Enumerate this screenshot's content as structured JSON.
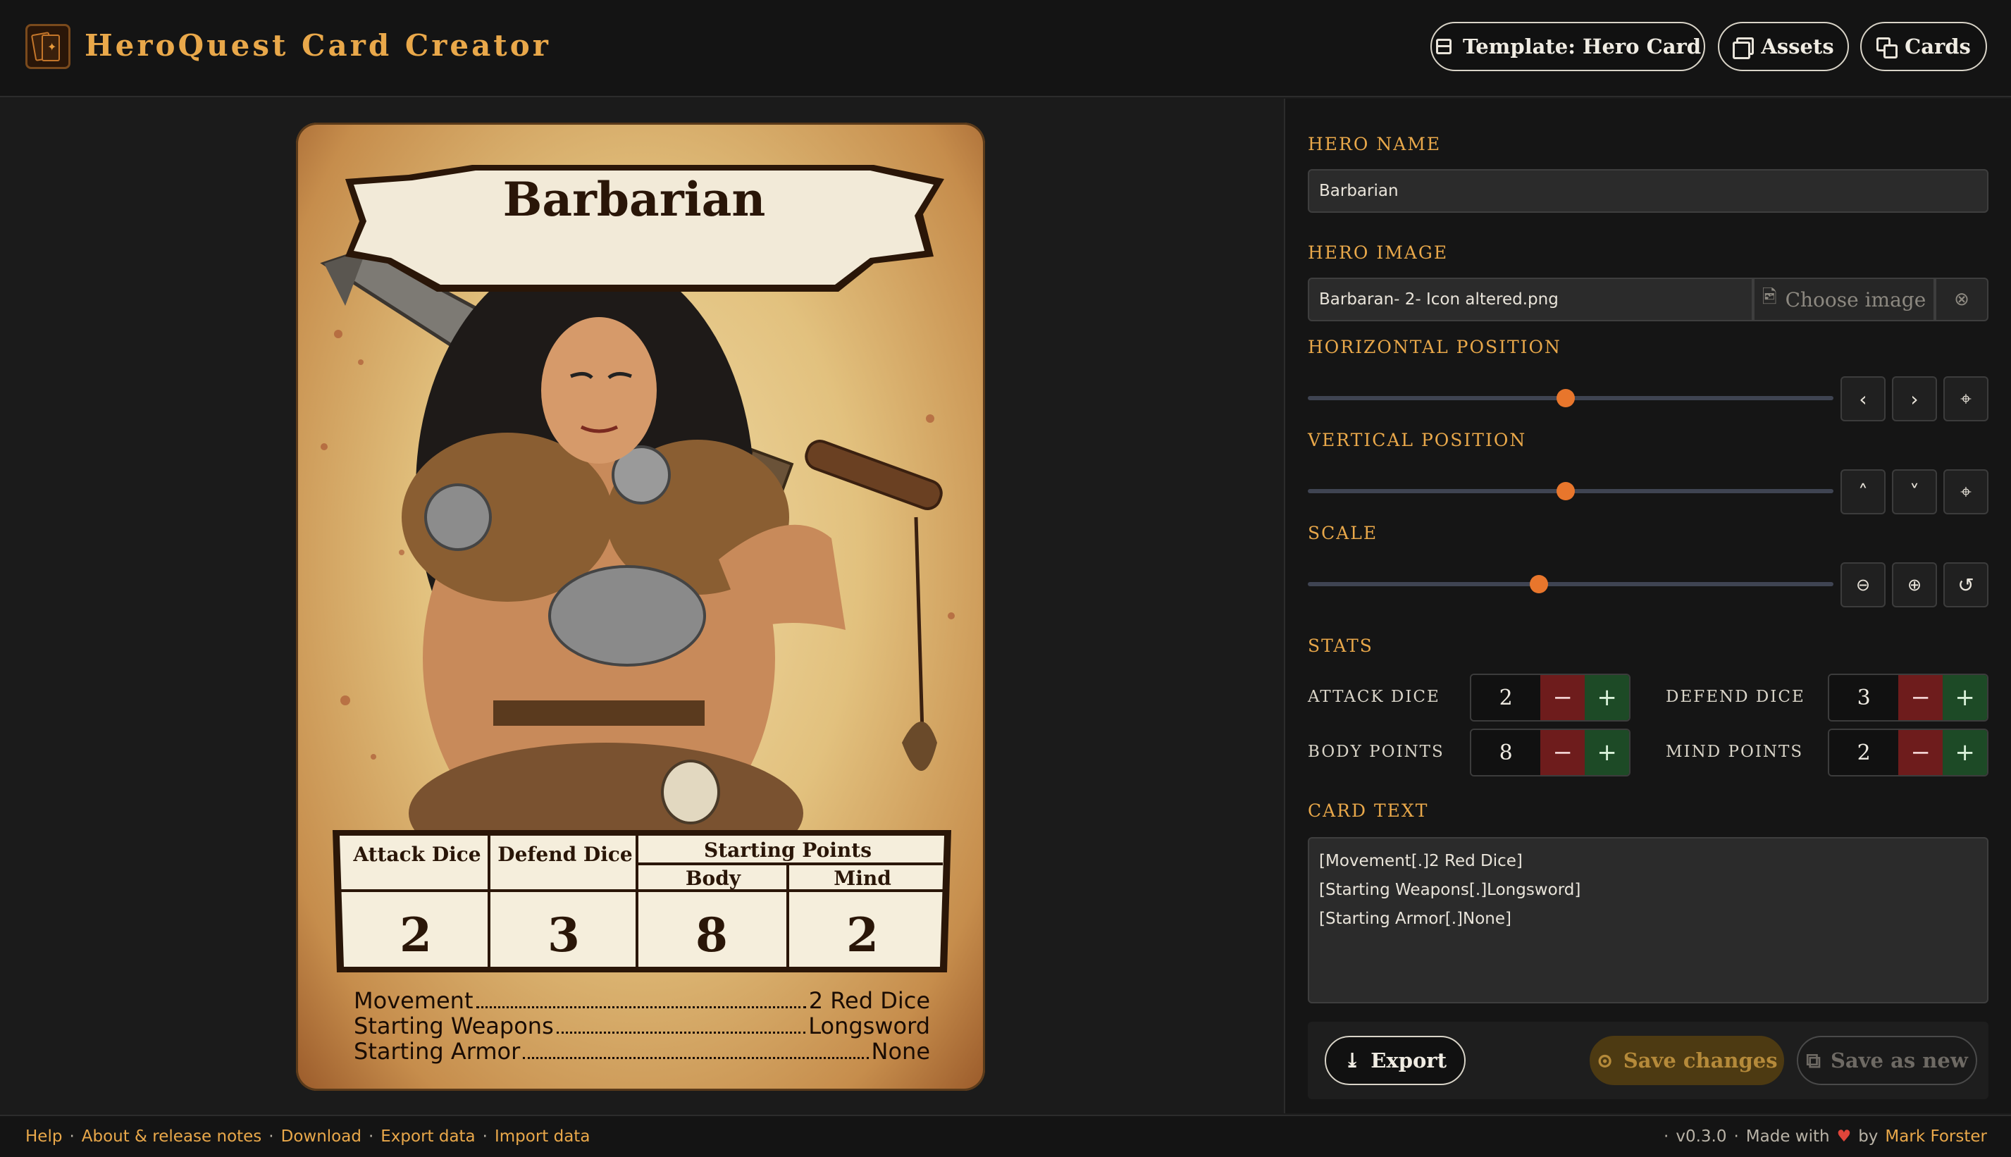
{
  "header": {
    "app_title": "HeroQuest Card Creator",
    "template_button": "Template: Hero Card",
    "assets_button": "Assets",
    "cards_button": "Cards"
  },
  "card": {
    "title": "Barbarian",
    "stat_headers": {
      "attack": "Attack Dice",
      "defend": "Defend Dice",
      "starting_points": "Starting Points",
      "body": "Body",
      "mind": "Mind"
    },
    "stats": {
      "attack": "2",
      "defend": "3",
      "body": "8",
      "mind": "2"
    },
    "lines": [
      {
        "label": "Movement",
        "value": "2 Red Dice"
      },
      {
        "label": "Starting Weapons",
        "value": "Longsword"
      },
      {
        "label": "Starting Armor",
        "value": "None"
      }
    ]
  },
  "editor": {
    "hero_name_label": "HERO NAME",
    "hero_name_value": "Barbarian",
    "hero_image_label": "HERO IMAGE",
    "hero_image_value": "Barbaran- 2- Icon altered.png",
    "choose_image_label": "Choose image",
    "horizontal_label": "HORIZONTAL POSITION",
    "horizontal_value": 0.49,
    "vertical_label": "VERTICAL POSITION",
    "vertical_value": 0.49,
    "scale_label": "SCALE",
    "scale_value": 0.44,
    "stats_label": "STATS",
    "stats": [
      {
        "label": "ATTACK DICE",
        "value": "2"
      },
      {
        "label": "DEFEND DICE",
        "value": "3"
      },
      {
        "label": "BODY POINTS",
        "value": "8"
      },
      {
        "label": "MIND POINTS",
        "value": "2"
      }
    ],
    "card_text_label": "CARD TEXT",
    "card_text_lines": [
      "[Movement[.]2 Red Dice]",
      "[Starting Weapons[.]Longsword]",
      "[Starting Armor[.]None]"
    ],
    "export_button": "Export",
    "save_changes_button": "Save changes",
    "save_as_new_button": "Save as new"
  },
  "footer": {
    "links": [
      "Help",
      "About & release notes",
      "Download",
      "Export data",
      "Import data"
    ],
    "version": "v0.3.0",
    "made_with": "Made with",
    "by": "by",
    "author": "Mark Forster"
  },
  "colors": {
    "accent": "#e9a84a",
    "slider": "#e8762c",
    "minus": "#6e1c1c",
    "plus": "#1d4a26",
    "heart": "#e0453a"
  }
}
